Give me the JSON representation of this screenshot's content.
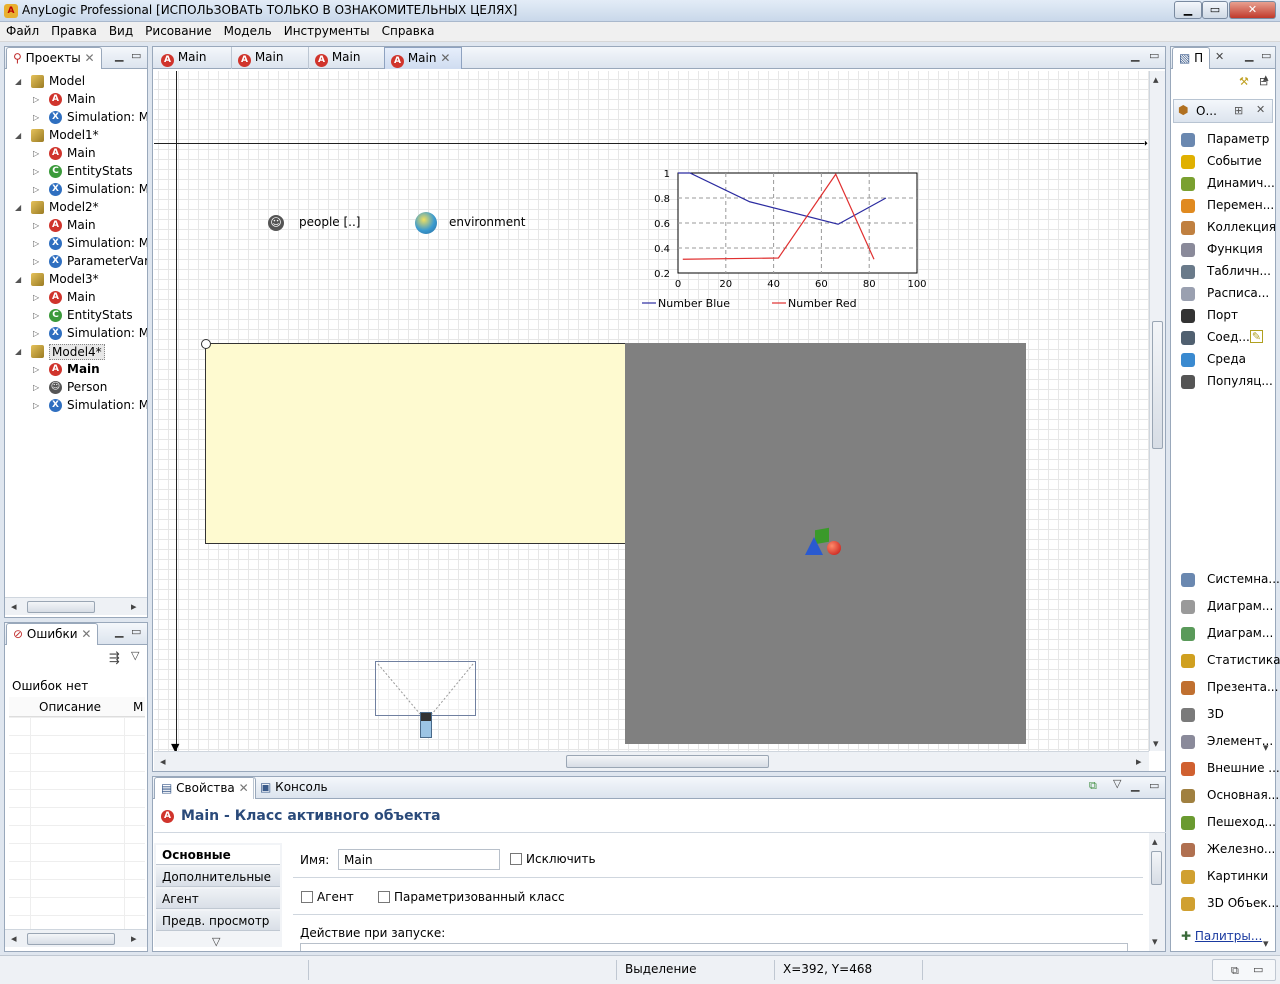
{
  "window": {
    "title": "AnyLogic Professional [ИСПОЛЬЗОВАТЬ ТОЛЬКО В ОЗНАКОМИТЕЛЬНЫХ ЦЕЛЯХ]",
    "min": "▁",
    "max": "▭",
    "close": "✕"
  },
  "menu": [
    "Файл",
    "Правка",
    "Вид",
    "Рисование",
    "Модель",
    "Инструменты",
    "Справка"
  ],
  "projects": {
    "tab_label": "Проекты",
    "items": [
      {
        "label": "Model",
        "type": "m",
        "level": 0,
        "open": true
      },
      {
        "label": "Main",
        "type": "a",
        "level": 1
      },
      {
        "label": "Simulation: M",
        "type": "x",
        "level": 1
      },
      {
        "label": "Model1*",
        "type": "m",
        "level": 0,
        "open": true
      },
      {
        "label": "Main",
        "type": "a",
        "level": 1
      },
      {
        "label": "EntityStats",
        "type": "c",
        "level": 1
      },
      {
        "label": "Simulation: M",
        "type": "x",
        "level": 1
      },
      {
        "label": "Model2*",
        "type": "m",
        "level": 0,
        "open": true
      },
      {
        "label": "Main",
        "type": "a",
        "level": 1
      },
      {
        "label": "Simulation: M",
        "type": "x",
        "level": 1
      },
      {
        "label": "ParameterVari",
        "type": "x",
        "level": 1
      },
      {
        "label": "Model3*",
        "type": "m",
        "level": 0,
        "open": true
      },
      {
        "label": "Main",
        "type": "a",
        "level": 1
      },
      {
        "label": "EntityStats",
        "type": "c",
        "level": 1
      },
      {
        "label": "Simulation: M",
        "type": "x",
        "level": 1
      },
      {
        "label": "Model4*",
        "type": "m",
        "level": 0,
        "open": true,
        "selected": true
      },
      {
        "label": "Main",
        "type": "a",
        "level": 1,
        "bold": true
      },
      {
        "label": "Person",
        "type": "p",
        "level": 1
      },
      {
        "label": "Simulation: M",
        "type": "x",
        "level": 1
      }
    ]
  },
  "errors": {
    "tab_label": "Ошибки",
    "status": "Ошибок нет",
    "col_desc": "Описание",
    "col_m": "M"
  },
  "editor": {
    "tabs": [
      "Main",
      "Main",
      "Main",
      "Main"
    ],
    "people_label": "people [..]",
    "environment_label": "environment"
  },
  "chart_data": {
    "type": "line",
    "xlim": [
      0,
      100
    ],
    "ylim": [
      0.2,
      1
    ],
    "xticks": [
      "0",
      "20",
      "40",
      "60",
      "80",
      "100"
    ],
    "yticks": [
      "1",
      "0.8",
      "0.6",
      "0.4",
      "0.2"
    ],
    "series": [
      {
        "name": "Number Blue",
        "color": "#2b2ba0",
        "x": [
          0,
          5,
          30,
          67,
          87
        ],
        "y": [
          1.02,
          1.0,
          0.77,
          0.59,
          0.8
        ]
      },
      {
        "name": "Number Red",
        "color": "#e03030",
        "x": [
          2,
          42,
          66,
          82
        ],
        "y": [
          0.31,
          0.32,
          0.99,
          0.31
        ]
      }
    ]
  },
  "properties": {
    "tab_label": "Свойства",
    "console_label": "Консоль",
    "header": "Main - Класс активного объекта",
    "nav": [
      "Основные",
      "Дополнительные",
      "Агент",
      "Предв. просмотр"
    ],
    "name_label": "Имя:",
    "name_value": "Main",
    "exclude_label": "Исключить",
    "agent_label": "Агент",
    "param_class_label": "Параметризованный класс",
    "startup_label": "Действие при запуске:"
  },
  "palette": {
    "tab_label": "П",
    "inner_label": "О...",
    "items": [
      {
        "label": "Параметр",
        "color": "#6a88b0"
      },
      {
        "label": "Событие",
        "color": "#e0b000"
      },
      {
        "label": "Динамич...",
        "color": "#7aa030"
      },
      {
        "label": "Перемен...",
        "color": "#e08a20"
      },
      {
        "label": "Коллекция",
        "color": "#c08040"
      },
      {
        "label": "Функция",
        "color": "#8a8a9a"
      },
      {
        "label": "Табличн...",
        "color": "#6a7a8a"
      },
      {
        "label": "Расписа...",
        "color": "#9aa0b0"
      },
      {
        "label": "Порт",
        "color": "#333333"
      },
      {
        "label": "Соед...",
        "color": "#506070"
      },
      {
        "label": "Среда",
        "color": "#3a8ad0"
      },
      {
        "label": "Популяц...",
        "color": "#555555"
      }
    ],
    "categories": [
      {
        "label": "Системна...",
        "color": "#6a88b0"
      },
      {
        "label": "Диаграм...",
        "color": "#9a9a9a"
      },
      {
        "label": "Диаграм...",
        "color": "#5a9a5a"
      },
      {
        "label": "Статистика",
        "color": "#d0a020"
      },
      {
        "label": "Презента...",
        "color": "#c07030"
      },
      {
        "label": "3D",
        "color": "#7a7a7a"
      },
      {
        "label": "Элемент...",
        "color": "#8a8a9a"
      },
      {
        "label": "Внешние ...",
        "color": "#d06030"
      },
      {
        "label": "Основная...",
        "color": "#a08040"
      },
      {
        "label": "Пешеход...",
        "color": "#6a9a30"
      },
      {
        "label": "Железно...",
        "color": "#b07050"
      },
      {
        "label": "Картинки",
        "color": "#d0a030"
      },
      {
        "label": "3D Объек...",
        "color": "#d0a030"
      }
    ],
    "palettes_link": "Палитры..."
  },
  "status": {
    "mode": "Выделение",
    "coords": "X=392, Y=468"
  }
}
